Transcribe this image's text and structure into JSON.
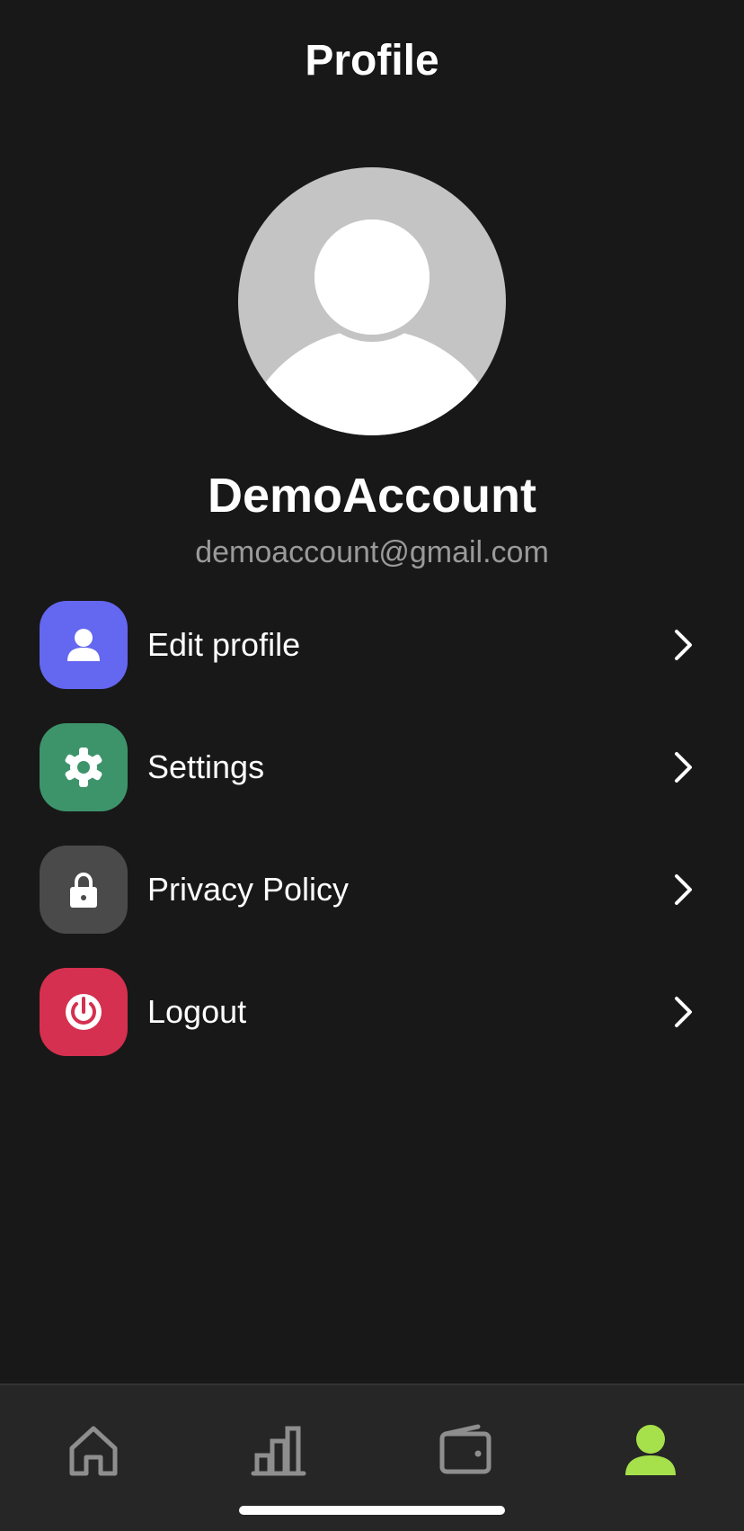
{
  "header": {
    "title": "Profile"
  },
  "profile": {
    "avatar_icon": "default-user-avatar",
    "name": "DemoAccount",
    "email": "demoaccount@gmail.com"
  },
  "menu": {
    "items": [
      {
        "label": "Edit profile",
        "icon": "person-icon",
        "color": "#6467F0"
      },
      {
        "label": "Settings",
        "icon": "gear-icon",
        "color": "#3D946B"
      },
      {
        "label": "Privacy Policy",
        "icon": "lock-icon",
        "color": "#4A4A4A"
      },
      {
        "label": "Logout",
        "icon": "power-icon",
        "color": "#D5304F"
      }
    ]
  },
  "tab_bar": {
    "tabs": [
      {
        "icon": "home-icon",
        "active": false
      },
      {
        "icon": "bar-chart-icon",
        "active": false
      },
      {
        "icon": "wallet-icon",
        "active": false
      },
      {
        "icon": "profile-icon",
        "active": true
      }
    ],
    "active_color": "#A6E04A",
    "inactive_color": "#8E8E8E"
  }
}
